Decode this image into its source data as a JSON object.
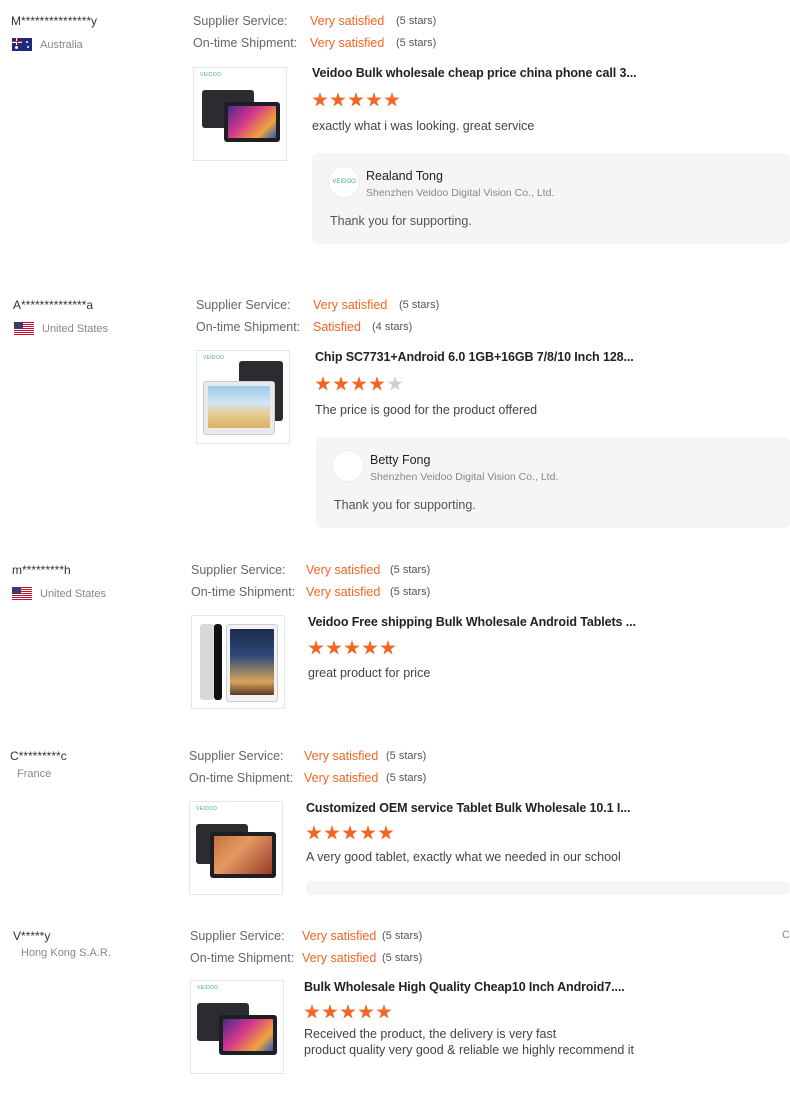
{
  "reviews": [
    {
      "user": "M***************y",
      "country": "Australia",
      "supplier_label": "Supplier Service:",
      "supplier_value": "Very satisfied",
      "supplier_stars": "(5 stars)",
      "shipment_label": "On-time Shipment:",
      "shipment_value": "Very satisfied",
      "shipment_stars": "(5 stars)",
      "product_brand": "VEIDOO",
      "product_title": "Veidoo Bulk wholesale cheap price china phone call 3...",
      "rating": 5,
      "comment": "exactly what i was looking. great service",
      "reply": {
        "avatar_text": "VEIDOO",
        "name": "Realand Tong",
        "company": "Shenzhen Veidoo Digital Vision Co., Ltd.",
        "text": "Thank you for supporting."
      }
    },
    {
      "user": "A**************a",
      "country": "United States",
      "supplier_label": "Supplier Service:",
      "supplier_value": "Very satisfied",
      "supplier_stars": "(5 stars)",
      "shipment_label": "On-time Shipment:",
      "shipment_value": "Satisfied",
      "shipment_stars": "(4 stars)",
      "product_brand": "VEIDOO",
      "product_title": "Chip SC7731+Android 6.0 1GB+16GB 7/8/10 Inch 128...",
      "rating": 4,
      "comment": "The price is good for the product offered",
      "reply": {
        "avatar_text": "",
        "name": "Betty Fong",
        "company": "Shenzhen Veidoo Digital Vision Co., Ltd.",
        "text": "Thank you for supporting."
      }
    },
    {
      "user": "m*********h",
      "country": "United States",
      "supplier_label": "Supplier Service:",
      "supplier_value": "Very satisfied",
      "supplier_stars": "(5 stars)",
      "shipment_label": "On-time Shipment:",
      "shipment_value": "Very satisfied",
      "shipment_stars": "(5 stars)",
      "product_title": "Veidoo Free shipping Bulk Wholesale Android Tablets ...",
      "rating": 5,
      "comment": "great product for price"
    },
    {
      "user": "C*********c",
      "country": "France",
      "supplier_label": "Supplier Service:",
      "supplier_value": "Very satisfied",
      "supplier_stars": "(5 stars)",
      "shipment_label": "On-time Shipment:",
      "shipment_value": "Very satisfied",
      "shipment_stars": "(5 stars)",
      "product_brand": "VEIDOO",
      "product_title": "Customized OEM service Tablet Bulk Wholesale 10.1 I...",
      "rating": 5,
      "comment": "A very good tablet, exactly what we needed in our school"
    },
    {
      "user": "V*****y",
      "country": "Hong Kong S.A.R.",
      "supplier_label": "Supplier Service:",
      "supplier_value": "Very satisfied",
      "supplier_stars": "(5 stars)",
      "shipment_label": "On-time Shipment:",
      "shipment_value": "Very satisfied",
      "shipment_stars": "(5 stars)",
      "product_brand": "VEIDOO",
      "product_title": "Bulk Wholesale High Quality Cheap10 Inch Android7....",
      "rating": 5,
      "comment_line1": "Received the product, the delivery is very fast",
      "comment_line2": "product quality very good & reliable  we highly recommend it"
    }
  ],
  "edge_mark": "C",
  "colors": {
    "accent": "#f26522",
    "reply_bg": "#f5f5f7"
  },
  "icons": [
    "flag-australia-icon",
    "flag-us-icon",
    "star-icon"
  ]
}
